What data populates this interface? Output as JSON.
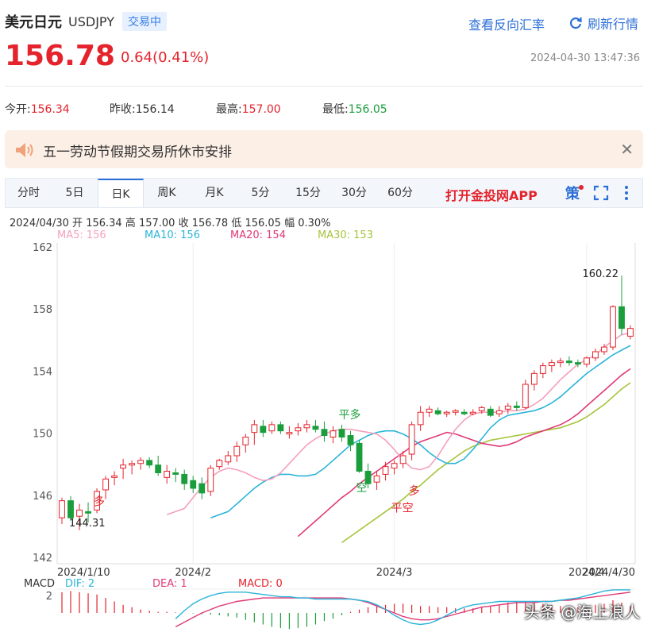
{
  "header": {
    "pair_name": "美元日元",
    "pair_code": "USDJPY",
    "status": "交易中",
    "reverse_link": "查看反向汇率",
    "refresh_label": "刷新行情",
    "price": "156.78",
    "change": "0.64(0.41%)",
    "timestamp": "2024-04-30 13:47:36"
  },
  "stats": {
    "open_label": "今开:",
    "open": "156.34",
    "prev_label": "昨收:",
    "prev": "156.14",
    "high_label": "最高:",
    "high": "157.00",
    "low_label": "最低:",
    "low": "156.05"
  },
  "notice": {
    "text": "五一劳动节假期交易所休市安排",
    "close": "✕"
  },
  "tabs": [
    "分时",
    "5日",
    "日K",
    "周K",
    "月K",
    "5分",
    "15分",
    "30分",
    "60分"
  ],
  "active_tab": "日K",
  "app_link": "打开金投网APP",
  "info_row": "2024/04/30  开 156.34  高 157.00  收 156.78  低 156.05  幅 0.30%",
  "ma_labels": {
    "ma5": "MA5: 156",
    "ma10": "MA10: 156",
    "ma20": "MA20: 154",
    "ma30": "MA30: 153"
  },
  "colors": {
    "up": "#e4232c",
    "down": "#1a9e3c",
    "ma5": "#f59fbd",
    "ma10": "#2bb4d8",
    "ma20": "#e03a78",
    "ma30": "#a5c43b"
  },
  "macd_labels": {
    "title": "MACD",
    "dif": "DIF: 2",
    "dea": "DEA: 1",
    "macd": "MACD: 0"
  },
  "watermark": "头条 @海上浪人",
  "chart_data": {
    "type": "candlestick",
    "ylim": [
      142,
      162
    ],
    "yticks": [
      "162",
      "158",
      "154",
      "150",
      "146",
      "142"
    ],
    "ytick_values": [
      162,
      158,
      154,
      150,
      146,
      142
    ],
    "xlabels": [
      "2024/1/10",
      "2024/2",
      "2024/3",
      "2024/4",
      "2024/4/30"
    ],
    "xlabel_index": [
      0,
      15,
      38,
      60,
      78
    ],
    "candles": [
      [
        144.6,
        145.9,
        144.2,
        145.7
      ],
      [
        145.7,
        146.0,
        144.4,
        144.6
      ],
      [
        144.7,
        145.5,
        143.8,
        145.1
      ],
      [
        145.0,
        145.6,
        144.3,
        144.9
      ],
      [
        145.1,
        146.5,
        144.9,
        146.3
      ],
      [
        146.4,
        147.3,
        145.8,
        147.1
      ],
      [
        147.2,
        147.6,
        146.7,
        147.3
      ],
      [
        147.8,
        148.4,
        147.1,
        148.0
      ],
      [
        148.0,
        148.3,
        147.4,
        148.1
      ],
      [
        148.1,
        148.5,
        147.7,
        148.3
      ],
      [
        148.3,
        148.5,
        147.8,
        148.0
      ],
      [
        148.0,
        148.6,
        147.3,
        147.5
      ],
      [
        147.2,
        148.0,
        146.8,
        147.6
      ],
      [
        147.5,
        147.8,
        146.9,
        147.4
      ],
      [
        147.4,
        147.7,
        146.4,
        146.8
      ],
      [
        147.0,
        147.3,
        146.2,
        146.5
      ],
      [
        146.8,
        147.2,
        145.8,
        146.2
      ],
      [
        146.3,
        148.0,
        146.0,
        147.8
      ],
      [
        147.9,
        148.4,
        147.7,
        148.3
      ],
      [
        148.2,
        148.9,
        148.0,
        148.6
      ],
      [
        148.6,
        149.5,
        148.2,
        149.2
      ],
      [
        149.3,
        150.0,
        148.8,
        149.8
      ],
      [
        150.1,
        150.9,
        149.3,
        150.6
      ],
      [
        150.5,
        150.9,
        149.8,
        150.1
      ],
      [
        150.2,
        150.8,
        150.0,
        150.6
      ],
      [
        150.6,
        150.8,
        150.0,
        150.2
      ],
      [
        150.0,
        150.5,
        149.7,
        150.1
      ],
      [
        150.2,
        150.7,
        149.9,
        150.4
      ],
      [
        150.4,
        150.9,
        150.1,
        150.6
      ],
      [
        150.5,
        150.9,
        150.1,
        150.3
      ],
      [
        150.3,
        150.8,
        149.5,
        149.9
      ],
      [
        149.8,
        150.5,
        149.4,
        150.2
      ],
      [
        150.3,
        150.6,
        149.5,
        149.8
      ],
      [
        149.9,
        150.2,
        148.9,
        149.3
      ],
      [
        149.4,
        149.6,
        147.5,
        147.6
      ],
      [
        147.6,
        148.1,
        146.5,
        146.8
      ],
      [
        146.9,
        147.6,
        146.4,
        147.3
      ],
      [
        147.4,
        148.2,
        147.0,
        147.9
      ],
      [
        147.8,
        148.3,
        147.4,
        148.1
      ],
      [
        148.1,
        148.9,
        147.8,
        148.6
      ],
      [
        148.7,
        150.8,
        148.3,
        150.6
      ],
      [
        150.6,
        151.8,
        150.2,
        151.4
      ],
      [
        151.4,
        151.8,
        151.1,
        151.6
      ],
      [
        151.5,
        151.7,
        151.2,
        151.3
      ],
      [
        151.3,
        151.5,
        151.1,
        151.4
      ],
      [
        151.4,
        151.6,
        151.2,
        151.5
      ],
      [
        151.4,
        151.6,
        151.2,
        151.3
      ],
      [
        151.3,
        151.6,
        151.2,
        151.4
      ],
      [
        151.5,
        151.8,
        151.3,
        151.7
      ],
      [
        151.6,
        151.8,
        151.1,
        151.2
      ],
      [
        151.3,
        151.8,
        151.1,
        151.5
      ],
      [
        151.6,
        152.0,
        151.3,
        151.8
      ],
      [
        151.8,
        152.1,
        151.5,
        151.7
      ],
      [
        151.7,
        153.5,
        151.6,
        153.2
      ],
      [
        153.2,
        154.1,
        152.8,
        153.9
      ],
      [
        153.9,
        154.6,
        153.6,
        154.4
      ],
      [
        154.4,
        154.8,
        154.0,
        154.6
      ],
      [
        154.6,
        154.9,
        154.3,
        154.7
      ],
      [
        154.7,
        155.0,
        154.4,
        154.6
      ],
      [
        154.6,
        154.8,
        154.3,
        154.5
      ],
      [
        154.5,
        155.0,
        154.3,
        154.9
      ],
      [
        154.9,
        155.5,
        154.7,
        155.3
      ],
      [
        155.3,
        155.8,
        155.1,
        155.6
      ],
      [
        155.6,
        158.3,
        155.4,
        158.2
      ],
      [
        158.2,
        160.2,
        156.4,
        156.8
      ],
      [
        156.3,
        157.0,
        156.1,
        156.8
      ]
    ],
    "ma_series": {
      "ma5": [
        144.8,
        145.0,
        145.2,
        145.9,
        146.6,
        147.2,
        147.6,
        147.8,
        147.7,
        147.5,
        147.2,
        147.0,
        147.1,
        147.5,
        148.1,
        148.7,
        149.3,
        149.7,
        150.0,
        150.2,
        150.3,
        150.3,
        150.2,
        150.1,
        150.0,
        149.6,
        149.0,
        148.3,
        147.8,
        147.7,
        147.9,
        148.6,
        149.5,
        150.3,
        150.9,
        151.3,
        151.4,
        151.4,
        151.4,
        151.5,
        151.5,
        151.6,
        151.9,
        152.3,
        152.9,
        153.5,
        154.0,
        154.5,
        154.8,
        155.1,
        155.6,
        156.0,
        156.4,
        156.5
      ],
      "ma10": [
        144.6,
        144.8,
        145.0,
        145.5,
        146.0,
        146.5,
        146.9,
        147.2,
        147.4,
        147.4,
        147.3,
        147.3,
        147.4,
        147.8,
        148.3,
        148.8,
        149.3,
        149.6,
        149.9,
        150.1,
        150.2,
        150.2,
        150.0,
        149.7,
        149.3,
        148.8,
        148.4,
        148.1,
        148.1,
        148.4,
        149.0,
        149.7,
        150.4,
        150.9,
        151.2,
        151.3,
        151.4,
        151.5,
        151.7,
        152.0,
        152.4,
        152.9,
        153.4,
        153.9,
        154.3,
        154.7,
        155.1,
        155.4,
        155.7
      ],
      "ma20": [
        143.4,
        143.9,
        144.4,
        144.9,
        145.4,
        145.9,
        146.3,
        146.8,
        147.2,
        147.6,
        148.0,
        148.4,
        148.8,
        149.2,
        149.5,
        149.7,
        149.9,
        150.1,
        150.0,
        149.8,
        149.6,
        149.4,
        149.3,
        149.2,
        149.3,
        149.5,
        149.8,
        150.0,
        150.2,
        150.4,
        150.6,
        150.9,
        151.3,
        151.8,
        152.3,
        152.8,
        153.3,
        153.8,
        154.2
      ],
      "ma30": [
        143.0,
        143.4,
        143.8,
        144.2,
        144.6,
        145.0,
        145.4,
        145.8,
        146.3,
        146.7,
        147.2,
        147.7,
        148.1,
        148.5,
        148.9,
        149.2,
        149.4,
        149.6,
        149.7,
        149.8,
        149.9,
        150.0,
        150.1,
        150.2,
        150.3,
        150.4,
        150.6,
        150.8,
        151.1,
        151.5,
        151.9,
        152.4,
        152.9,
        153.3
      ]
    },
    "annotations": [
      "160.22",
      "144.31",
      "平多",
      "空",
      "平空",
      "多",
      "多"
    ],
    "macd": {
      "bars": [
        1.8,
        1.9,
        1.8,
        1.7,
        1.6,
        1.3,
        1.0,
        0.7,
        0.5,
        0.3,
        0.2,
        0.1,
        0.1,
        0.05,
        0.0,
        -0.05,
        -0.1,
        -0.15,
        -0.2,
        -0.3,
        -0.4,
        -0.6,
        -0.8,
        -1.0,
        -1.2,
        -1.3,
        -1.4,
        -1.3,
        -1.2,
        -1.0,
        -0.7,
        -0.5,
        -0.2,
        0.1,
        0.3,
        0.5,
        0.6,
        0.7,
        0.8,
        0.8,
        0.7,
        0.6,
        0.6,
        0.5,
        0.5,
        0.4,
        0.4,
        0.4,
        0.5,
        0.6,
        0.7,
        0.9,
        1.0,
        1.0,
        0.9,
        0.8,
        0.7,
        0.6,
        0.5,
        0.5,
        0.6,
        0.7,
        0.8,
        1.1,
        0.9,
        0.6
      ],
      "dif": [
        -0.5,
        0.2,
        0.8,
        1.2,
        1.5,
        1.7,
        1.8,
        1.8,
        1.8,
        1.7,
        1.6,
        1.5,
        1.4,
        1.4,
        1.3,
        1.3,
        1.2,
        1.2,
        1.2,
        1.2,
        1.2,
        1.1,
        1.0,
        0.7,
        0.3,
        -0.2,
        -0.6,
        -0.9,
        -1.0,
        -0.9,
        -0.6,
        -0.2,
        0.2,
        0.5,
        0.7,
        0.8,
        0.9,
        1.0,
        1.0,
        1.0,
        1.0,
        1.0,
        1.0,
        1.0,
        1.1,
        1.2,
        1.3,
        1.5,
        1.7,
        1.9,
        2.0,
        2.0,
        2.0
      ],
      "dea": [
        -1.2,
        -0.8,
        -0.4,
        0.0,
        0.3,
        0.6,
        0.8,
        1.0,
        1.1,
        1.2,
        1.3,
        1.3,
        1.3,
        1.3,
        1.3,
        1.3,
        1.3,
        1.3,
        1.3,
        1.3,
        1.2,
        1.1,
        0.9,
        0.6,
        0.3,
        0.0,
        -0.3,
        -0.5,
        -0.6,
        -0.6,
        -0.5,
        -0.3,
        -0.1,
        0.1,
        0.3,
        0.5,
        0.6,
        0.7,
        0.8,
        0.9,
        0.9,
        0.9,
        1.0,
        1.0,
        1.1,
        1.1,
        1.2,
        1.3,
        1.4,
        1.5,
        1.6,
        1.7,
        1.8
      ],
      "ylabel": "2"
    }
  }
}
